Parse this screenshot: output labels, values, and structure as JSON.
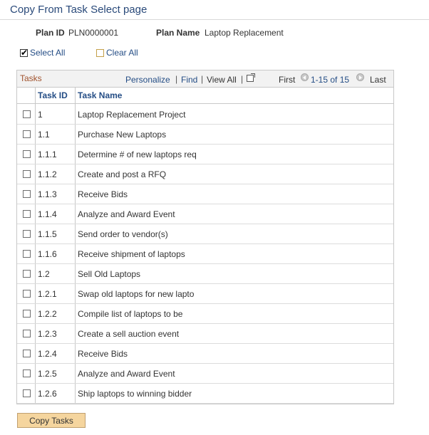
{
  "page": {
    "title": "Copy From Task Select page"
  },
  "header": {
    "plan_id_label": "Plan ID",
    "plan_id_value": "PLN0000001",
    "plan_name_label": "Plan Name",
    "plan_name_value": "Laptop Replacement"
  },
  "selection": {
    "select_all": "Select All",
    "select_all_checked": true,
    "clear_all": "Clear All",
    "clear_all_checked": false
  },
  "grid": {
    "title": "Tasks",
    "personalize": "Personalize",
    "sep1": "|",
    "find": "Find",
    "sep2": "|",
    "view_all": "View All",
    "sep3": "|",
    "first": "First",
    "range": "1-15 of 15",
    "last": "Last",
    "columns": {
      "task_id": "Task ID",
      "task_name": "Task Name"
    }
  },
  "tasks": [
    {
      "id": "1",
      "name": "Laptop Replacement Project",
      "checked": false
    },
    {
      "id": "1.1",
      "name": "Purchase New Laptops",
      "checked": false
    },
    {
      "id": "1.1.1",
      "name": "Determine # of new laptops req",
      "checked": false
    },
    {
      "id": "1.1.2",
      "name": "Create and post a RFQ",
      "checked": false
    },
    {
      "id": "1.1.3",
      "name": "Receive Bids",
      "checked": false
    },
    {
      "id": "1.1.4",
      "name": "Analyze and Award Event",
      "checked": false
    },
    {
      "id": "1.1.5",
      "name": "Send order to vendor(s)",
      "checked": false
    },
    {
      "id": "1.1.6",
      "name": "Receive shipment of laptops",
      "checked": false
    },
    {
      "id": "1.2",
      "name": "Sell Old Laptops",
      "checked": false
    },
    {
      "id": "1.2.1",
      "name": "Swap old laptops for new lapto",
      "checked": false
    },
    {
      "id": "1.2.2",
      "name": "Compile list of laptops to be",
      "checked": false
    },
    {
      "id": "1.2.3",
      "name": "Create a sell auction event",
      "checked": false
    },
    {
      "id": "1.2.4",
      "name": "Receive Bids",
      "checked": false
    },
    {
      "id": "1.2.5",
      "name": "Analyze and Award Event",
      "checked": false
    },
    {
      "id": "1.2.6",
      "name": "Ship laptops to winning bidder",
      "checked": false
    }
  ],
  "actions": {
    "copy_tasks": "Copy Tasks"
  }
}
